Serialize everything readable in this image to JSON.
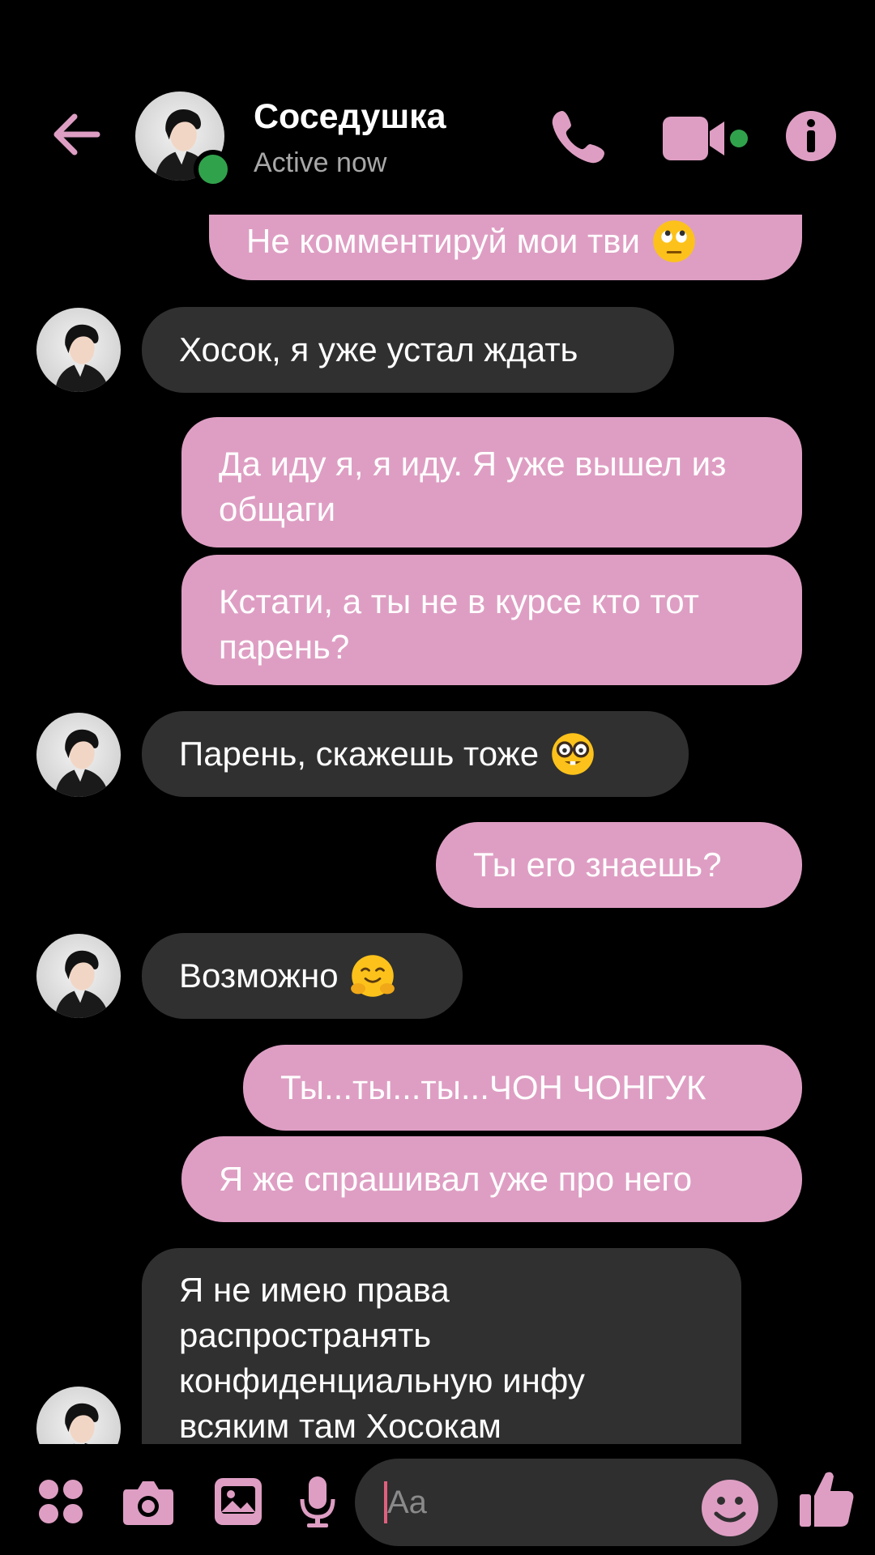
{
  "header": {
    "contact_name": "Соседушка",
    "status": "Active now",
    "back_icon": "arrow-left-icon",
    "call_icon": "phone-icon",
    "video_icon": "video-camera-icon",
    "info_icon": "info-icon"
  },
  "messages": [
    {
      "direction": "out",
      "text": "Не комментируй мои тви",
      "emoji": "face-with-rolling-eyes"
    },
    {
      "direction": "in",
      "text": "Хосок, я уже устал ждать"
    },
    {
      "direction": "out",
      "text": "Да иду я, я иду. Я уже вышел из общаги"
    },
    {
      "direction": "out",
      "text": "Кстати, а ты не в курсе кто тот парень?"
    },
    {
      "direction": "in",
      "text": "Парень, скажешь тоже",
      "emoji": "nerd-face"
    },
    {
      "direction": "out",
      "text": "Ты его знаешь?"
    },
    {
      "direction": "in",
      "text": "Возможно",
      "emoji": "hugging-face"
    },
    {
      "direction": "out",
      "text": "Ты...ты...ты...ЧОН ЧОНГУК"
    },
    {
      "direction": "out",
      "text": "Я же спрашивал уже про него"
    },
    {
      "direction": "in",
      "text": "Я не имею права распространять конфиденциальную инфу всяким там Хосокам"
    }
  ],
  "composer": {
    "placeholder": "Aa",
    "icons": [
      "apps-menu-icon",
      "camera-icon",
      "gallery-icon",
      "microphone-icon",
      "emoji-icon",
      "thumbs-up-icon"
    ]
  },
  "colors": {
    "background": "#000000",
    "accent": "#de9ec3",
    "incoming_bubble": "#303030",
    "active_dot": "#31a24c"
  }
}
